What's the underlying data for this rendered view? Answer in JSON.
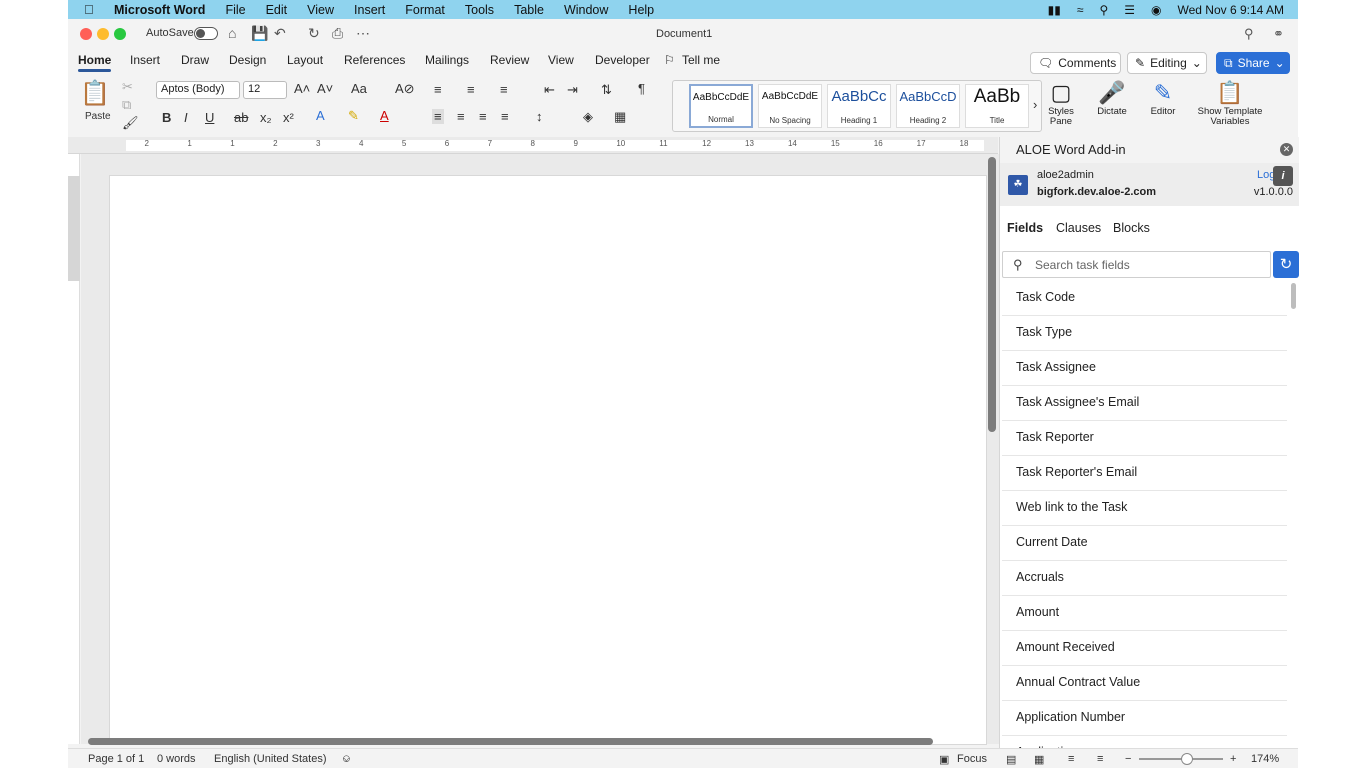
{
  "menubar": {
    "app_name": "Microsoft Word",
    "items": [
      "File",
      "Edit",
      "View",
      "Insert",
      "Format",
      "Tools",
      "Table",
      "Window",
      "Help"
    ],
    "datetime": "Wed Nov 6  9:14 AM"
  },
  "titlebar": {
    "autosave_label": "AutoSave",
    "document_title": "Document1"
  },
  "ribbon_tabs": [
    "Home",
    "Insert",
    "Draw",
    "Design",
    "Layout",
    "References",
    "Mailings",
    "Review",
    "View",
    "Developer"
  ],
  "tell_me": "Tell me",
  "ribbon_buttons": {
    "comments": "Comments",
    "editing": "Editing",
    "share": "Share"
  },
  "home": {
    "paste_label": "Paste",
    "font_name": "Aptos (Body)",
    "font_size": "12",
    "styles": [
      {
        "sample": "AaBbCcDdE",
        "name": "Normal"
      },
      {
        "sample": "AaBbCcDdE",
        "name": "No Spacing"
      },
      {
        "sample": "AaBbCc",
        "name": "Heading 1"
      },
      {
        "sample": "AaBbCcD",
        "name": "Heading 2"
      },
      {
        "sample": "AaBb",
        "name": "Title"
      }
    ],
    "styles_pane_label": "Styles\nPane",
    "dictate_label": "Dictate",
    "editor_label": "Editor",
    "template_label": "Show Template\nVariables"
  },
  "ruler_numbers": [
    "2",
    "1",
    "1",
    "2",
    "3",
    "4",
    "5",
    "6",
    "7",
    "8",
    "9",
    "10",
    "11",
    "12",
    "13",
    "14",
    "15",
    "16",
    "17",
    "18"
  ],
  "statusbar": {
    "page": "Page 1 of 1",
    "words": "0 words",
    "language": "English (United States)",
    "focus": "Focus",
    "zoom": "174%"
  },
  "addin": {
    "title": "ALOE Word Add-in",
    "username": "aloe2admin",
    "host": "bigfork.dev.aloe-2.com",
    "logout": "Log",
    "version": "v1.0.0.0",
    "tabs": [
      "Fields",
      "Clauses",
      "Blocks"
    ],
    "search_placeholder": "Search task fields",
    "fields": [
      "Task Code",
      "Task Type",
      "Task Assignee",
      "Task Assignee's Email",
      "Task Reporter",
      "Task Reporter's Email",
      "Web link to the Task",
      "Current Date",
      "Accruals",
      "Amount",
      "Amount Received",
      "Annual Contract Value",
      "Application Number",
      "Application"
    ]
  },
  "colors": {
    "menubar_bg": "#8fd3ee",
    "accent_blue": "#2b6fd6",
    "tab_underline": "#2b579a"
  }
}
